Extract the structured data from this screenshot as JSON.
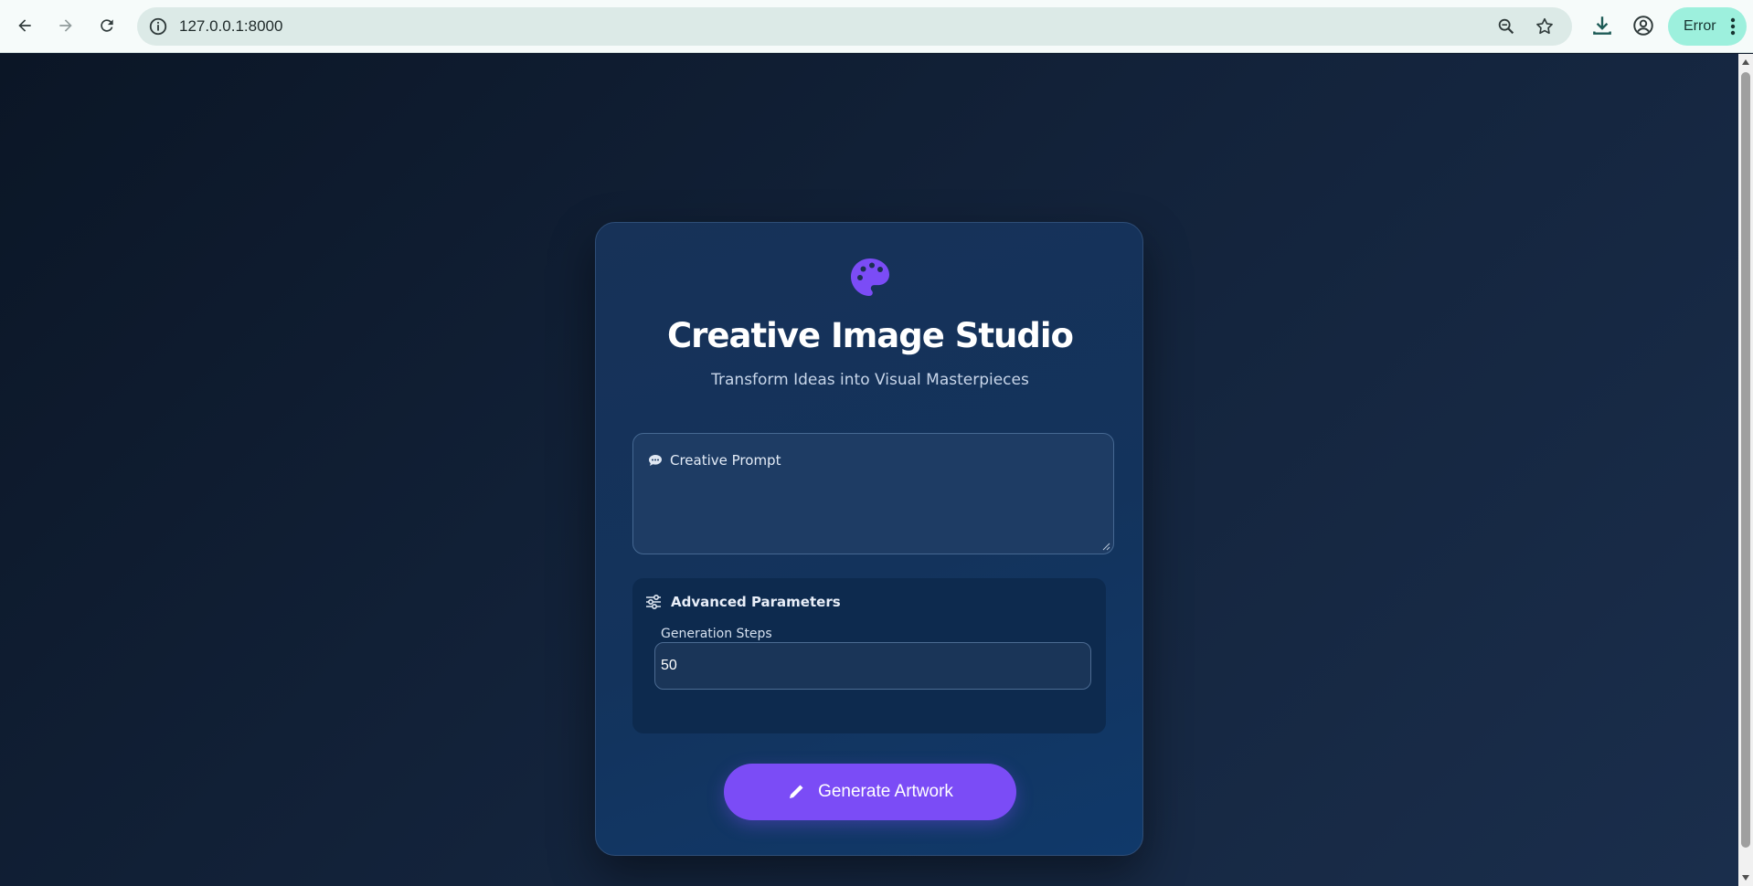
{
  "browser": {
    "url": "127.0.0.1:8000",
    "profile_status": "Error",
    "icons": {
      "back": "arrow-left-icon",
      "forward": "arrow-right-icon",
      "reload": "reload-icon",
      "site_info": "info-icon",
      "zoom": "zoom-icon",
      "bookmark": "star-icon",
      "downloads": "download-icon",
      "profile": "account-icon",
      "menu": "kebab-menu-icon"
    }
  },
  "app": {
    "logo_icon": "palette-icon",
    "title": "Creative Image Studio",
    "subtitle": "Transform Ideas into Visual Masterpieces",
    "prompt": {
      "icon": "comment-icon",
      "label": "Creative Prompt",
      "value": ""
    },
    "advanced": {
      "icon": "sliders-icon",
      "heading": "Advanced Parameters",
      "steps_label": "Generation Steps",
      "steps_value": "50"
    },
    "generate_button": {
      "icon": "pencil-icon",
      "label": "Generate Artwork"
    }
  },
  "colors": {
    "accent": "#7b4cf6",
    "background": "#0f1b2d",
    "card": "#13335c",
    "error_pill": "#9df0dd"
  }
}
